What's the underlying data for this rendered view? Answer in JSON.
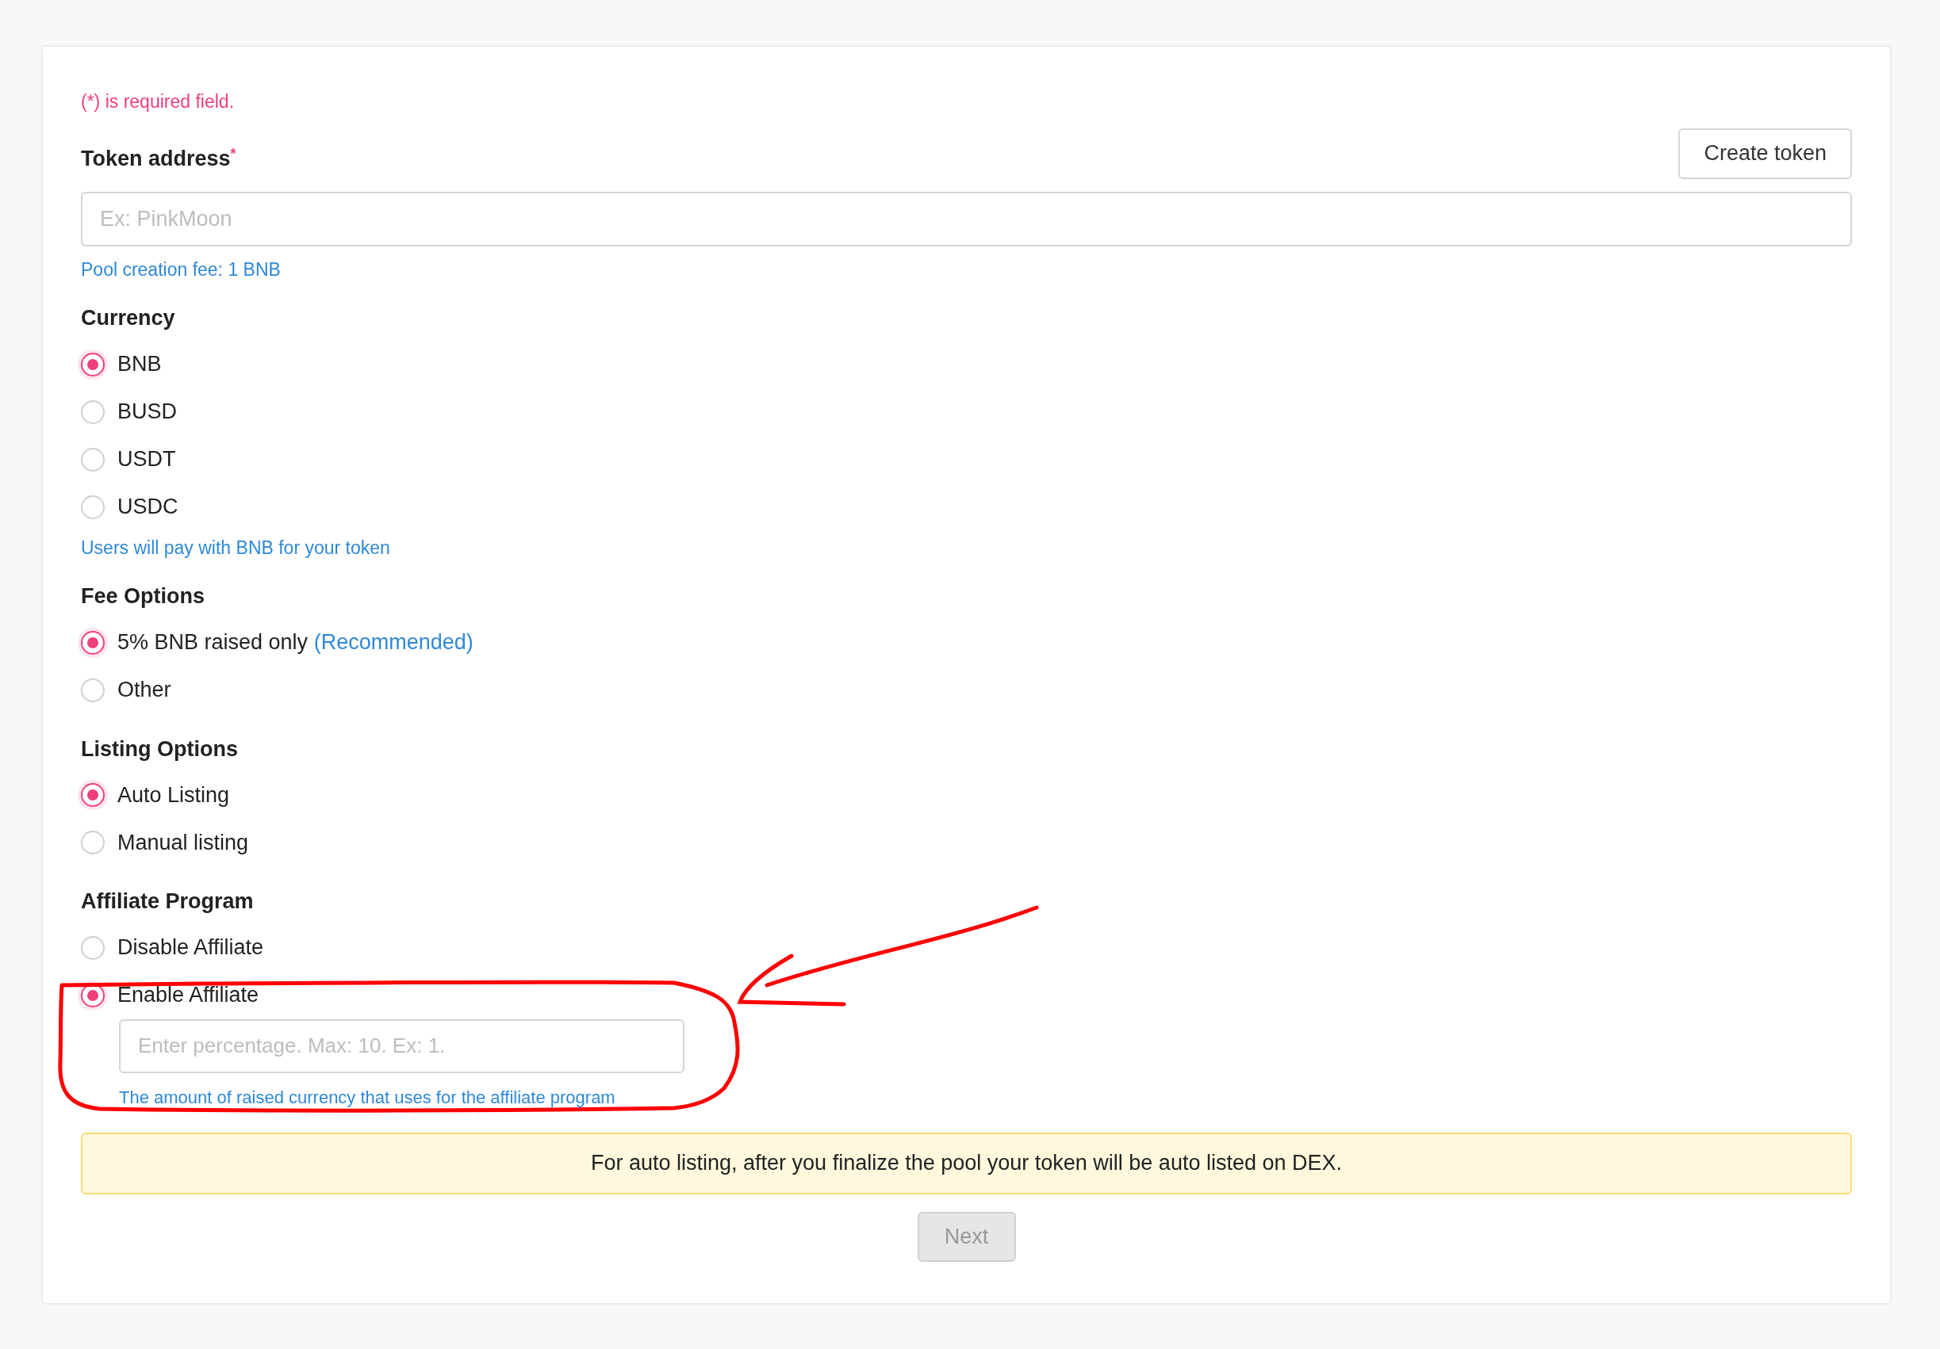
{
  "required_note": "(*) is required field.",
  "token_address": {
    "label": "Token address",
    "required_mark": "*",
    "placeholder": "Ex: PinkMoon",
    "create_button": "Create token",
    "hint": "Pool creation fee: 1 BNB"
  },
  "groups": [
    {
      "title": "Currency",
      "options": [
        {
          "label": "BNB",
          "selected": true
        },
        {
          "label": "BUSD",
          "selected": false
        },
        {
          "label": "USDT",
          "selected": false
        },
        {
          "label": "USDC",
          "selected": false
        }
      ],
      "hint": "Users will pay with BNB for your token"
    },
    {
      "title": "Fee Options",
      "options": [
        {
          "label": "5% BNB raised only",
          "note": "(Recommended)",
          "selected": true
        },
        {
          "label": "Other",
          "selected": false
        }
      ]
    },
    {
      "title": "Listing Options",
      "options": [
        {
          "label": "Auto Listing",
          "selected": true
        },
        {
          "label": "Manual listing",
          "selected": false
        }
      ]
    },
    {
      "title": "Affiliate Program",
      "options": [
        {
          "label": "Disable Affiliate",
          "selected": false
        },
        {
          "label": "Enable Affiliate",
          "selected": true,
          "field": {
            "placeholder": "Enter percentage. Max: 10. Ex: 1.",
            "hint": "The amount of raised currency that uses for the affiliate program"
          }
        }
      ]
    }
  ],
  "notice": "For auto listing, after you finalize the pool your token will be auto listed on DEX.",
  "next_button": {
    "label": "Next",
    "disabled": true
  }
}
